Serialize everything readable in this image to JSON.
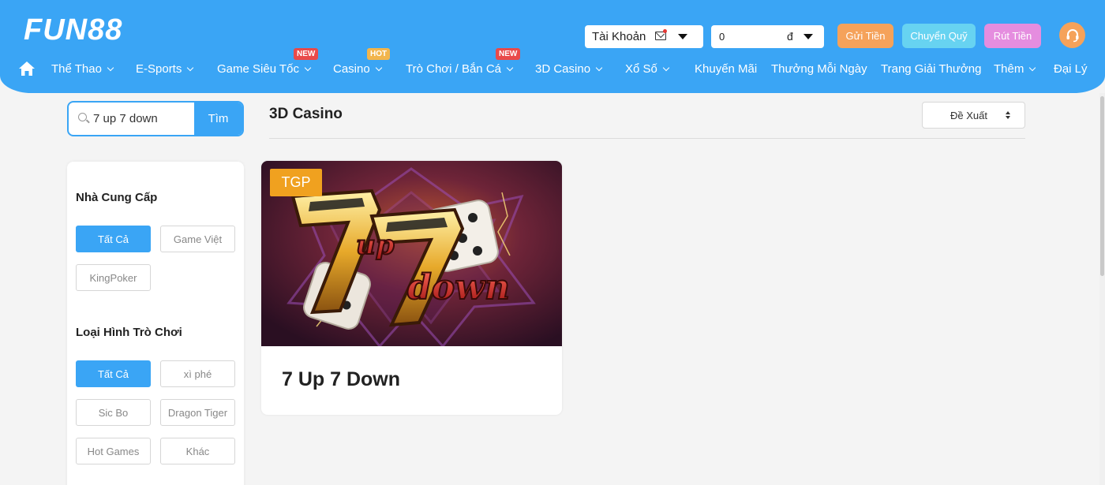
{
  "brand": {
    "logo_text": "FUN88",
    "accent": "#3aa5f5"
  },
  "header": {
    "account_label": "Tài Khoản",
    "balance_value": "0",
    "currency": "đ",
    "deposit_label": "Gửi Tiền",
    "transfer_label": "Chuyển Quỹ",
    "withdraw_label": "Rút Tiền",
    "support_icon": "headset-icon"
  },
  "nav": {
    "home_icon": "home-icon",
    "items": [
      {
        "label": "Thể Thao"
      },
      {
        "label": "E-Sports"
      },
      {
        "label": "Game Siêu Tốc",
        "badge": "NEW"
      },
      {
        "label": "Casino",
        "badge": "HOT"
      },
      {
        "label": "Trò Chơi / Bắn Cá",
        "badge": "NEW"
      },
      {
        "label": "3D Casino"
      },
      {
        "label": "Xổ Số"
      },
      {
        "label": "Khuyến Mãi"
      },
      {
        "label": "Thưởng Mỗi Ngày"
      },
      {
        "label": "Trang Giải Thưởng"
      },
      {
        "label": "Thêm"
      },
      {
        "label": "Đại Lý"
      }
    ]
  },
  "search": {
    "value": "7 up 7 down",
    "button_label": "Tìm"
  },
  "main": {
    "section_title": "3D Casino",
    "sort_label": "Đề Xuất"
  },
  "filters": {
    "providers": {
      "heading": "Nhà Cung Cấp",
      "options": [
        "Tất Cả",
        "Game Việt",
        "KingPoker"
      ]
    },
    "game_types": {
      "heading": "Loại Hình Trò Chơi",
      "options": [
        "Tất Cả",
        "xì phé",
        "Sic Bo",
        "Dragon Tiger",
        "Hot Games",
        "Khác"
      ]
    }
  },
  "games": [
    {
      "provider": "TGP",
      "title": "7 Up 7 Down",
      "art_text": "7up7down"
    }
  ]
}
